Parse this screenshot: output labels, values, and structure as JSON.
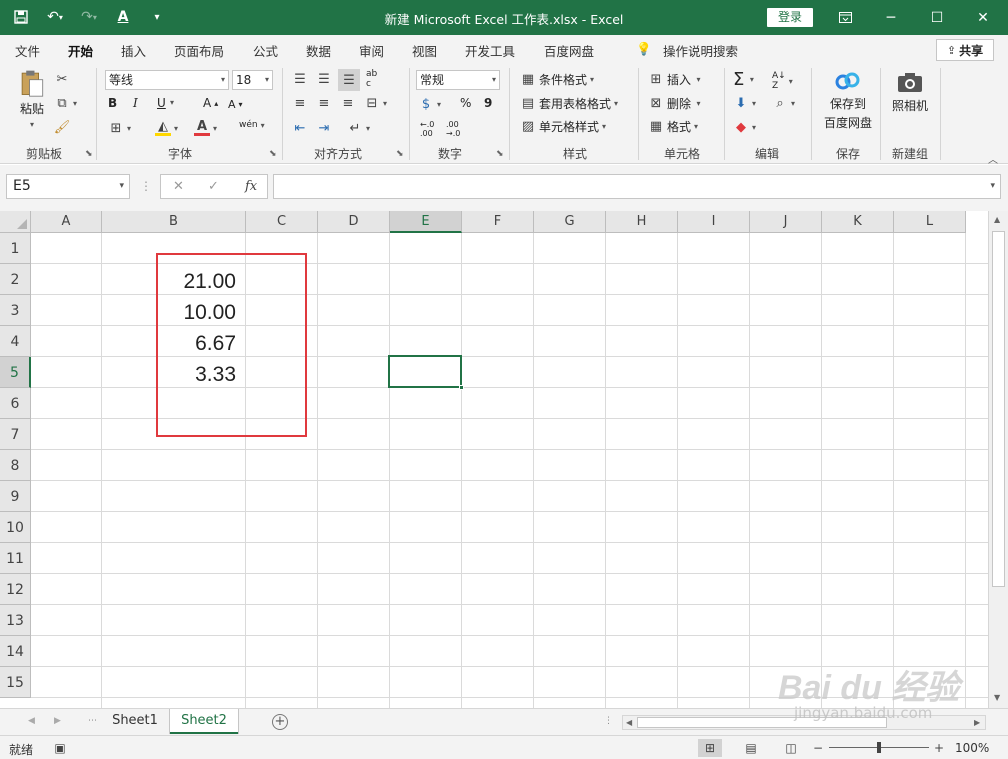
{
  "title_bar": {
    "title": "新建 Microsoft Excel 工作表.xlsx  -  Excel",
    "login": "登录"
  },
  "ribbon_tabs": [
    "文件",
    "开始",
    "插入",
    "页面布局",
    "公式",
    "数据",
    "审阅",
    "视图",
    "开发工具",
    "百度网盘"
  ],
  "active_tab": "开始",
  "tell_me": "操作说明搜索",
  "share": "共享",
  "ribbon": {
    "clipboard": {
      "paste": "粘贴",
      "label": "剪贴板"
    },
    "font": {
      "name": "等线",
      "size": "18",
      "label": "字体",
      "bold": "B",
      "italic": "I",
      "underline": "U",
      "wen": "wén"
    },
    "alignment": {
      "label": "对齐方式"
    },
    "number": {
      "format": "常规",
      "percent": "%",
      "comma": "9",
      "label": "数字"
    },
    "styles": {
      "conditional": "条件格式",
      "table": "套用表格格式",
      "cell_styles": "单元格样式",
      "label": "样式"
    },
    "cells": {
      "insert": "插入",
      "delete": "删除",
      "format": "格式",
      "label": "单元格"
    },
    "editing": {
      "label": "编辑"
    },
    "save": {
      "line1": "保存到",
      "line2": "百度网盘",
      "label": "保存"
    },
    "camera": {
      "name": "照相机",
      "label": "新建组"
    }
  },
  "formula_bar": {
    "name_box": "E5",
    "fx": "fx",
    "value": ""
  },
  "columns": [
    "A",
    "B",
    "C",
    "D",
    "E",
    "F",
    "G",
    "H",
    "I",
    "J",
    "K",
    "L"
  ],
  "rows": [
    "1",
    "2",
    "3",
    "4",
    "5",
    "6",
    "7",
    "8",
    "9",
    "10",
    "11",
    "12",
    "13",
    "14",
    "15"
  ],
  "selected_column": "E",
  "selected_row": "5",
  "cells": [
    {
      "ref": "B2",
      "value": "21.00"
    },
    {
      "ref": "B3",
      "value": "10.00"
    },
    {
      "ref": "B4",
      "value": "6.67"
    },
    {
      "ref": "B5",
      "value": "3.33"
    }
  ],
  "sheets": [
    "Sheet1",
    "Sheet2"
  ],
  "active_sheet": "Sheet2",
  "status": {
    "ready": "就绪",
    "zoom": "100%"
  },
  "watermark": {
    "main": "Bai du 经验",
    "sub": "jingyan.baidu.com"
  },
  "colors": {
    "accent": "#217346",
    "highlight": "#e0393e"
  }
}
